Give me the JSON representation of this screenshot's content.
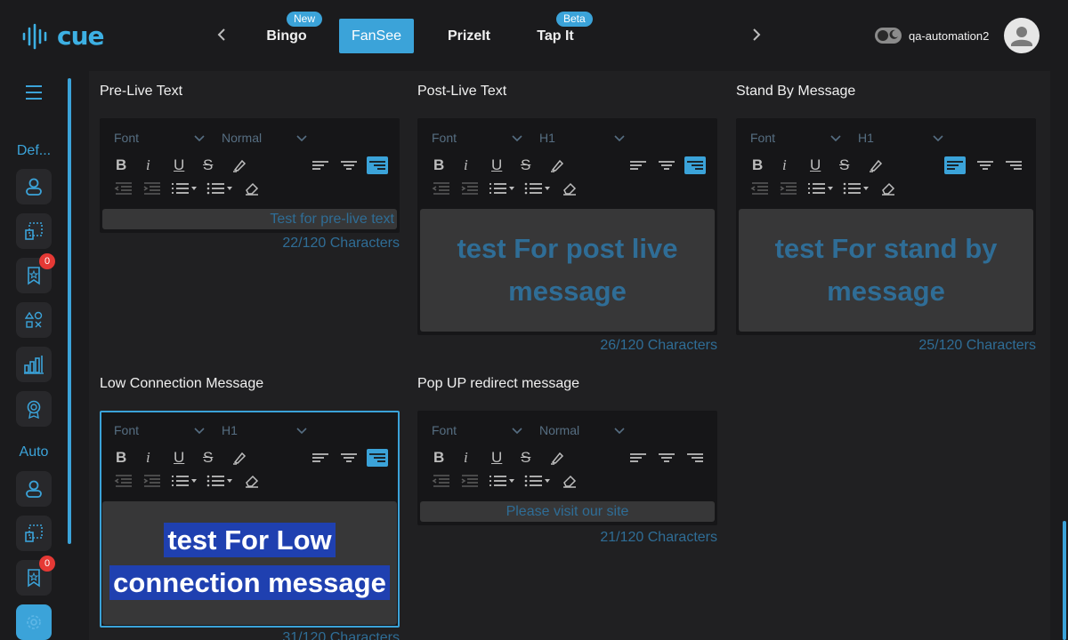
{
  "app": {
    "logo_text": "cue"
  },
  "nav": {
    "tabs": [
      {
        "label": "Bingo",
        "badge": "New"
      },
      {
        "label": "FanSee",
        "active": true
      },
      {
        "label": "PrizeIt"
      },
      {
        "label": "Tap It",
        "badge": "Beta"
      }
    ],
    "prev_icon": "chevron-left-icon",
    "next_icon": "chevron-right-icon"
  },
  "user": {
    "name": "qa-automation2"
  },
  "sidebar": {
    "section1_label": "Def...",
    "section2_label": "Auto",
    "notif_count_1": "0",
    "notif_count_2": "0"
  },
  "editors": [
    {
      "title": "Pre-Live Text",
      "font": "Font",
      "size": "Normal",
      "align": "right",
      "text": "Test for pre-live text",
      "counter": "22/120 Characters"
    },
    {
      "title": "Post-Live Text",
      "font": "Font",
      "size": "H1",
      "align": "right",
      "text": "test For post live message",
      "counter": "26/120 Characters"
    },
    {
      "title": "Stand By Message",
      "font": "Font",
      "size": "H1",
      "align": "left",
      "text": "test For stand by message",
      "counter": "25/120 Characters"
    },
    {
      "title": "Low Connection Message",
      "font": "Font",
      "size": "H1",
      "align": "right",
      "text_line1": "test For Low",
      "text_line2": "connection message",
      "counter": "31/120 Characters"
    },
    {
      "title": "Pop UP redirect message",
      "font": "Font",
      "size": "Normal",
      "align": "none",
      "text": "Please visit our site",
      "counter": "21/120 Characters"
    }
  ],
  "colors": {
    "accent": "#3ba3d9",
    "placeholder_text": "#2f6d96",
    "bg": "#1b1b1d"
  }
}
